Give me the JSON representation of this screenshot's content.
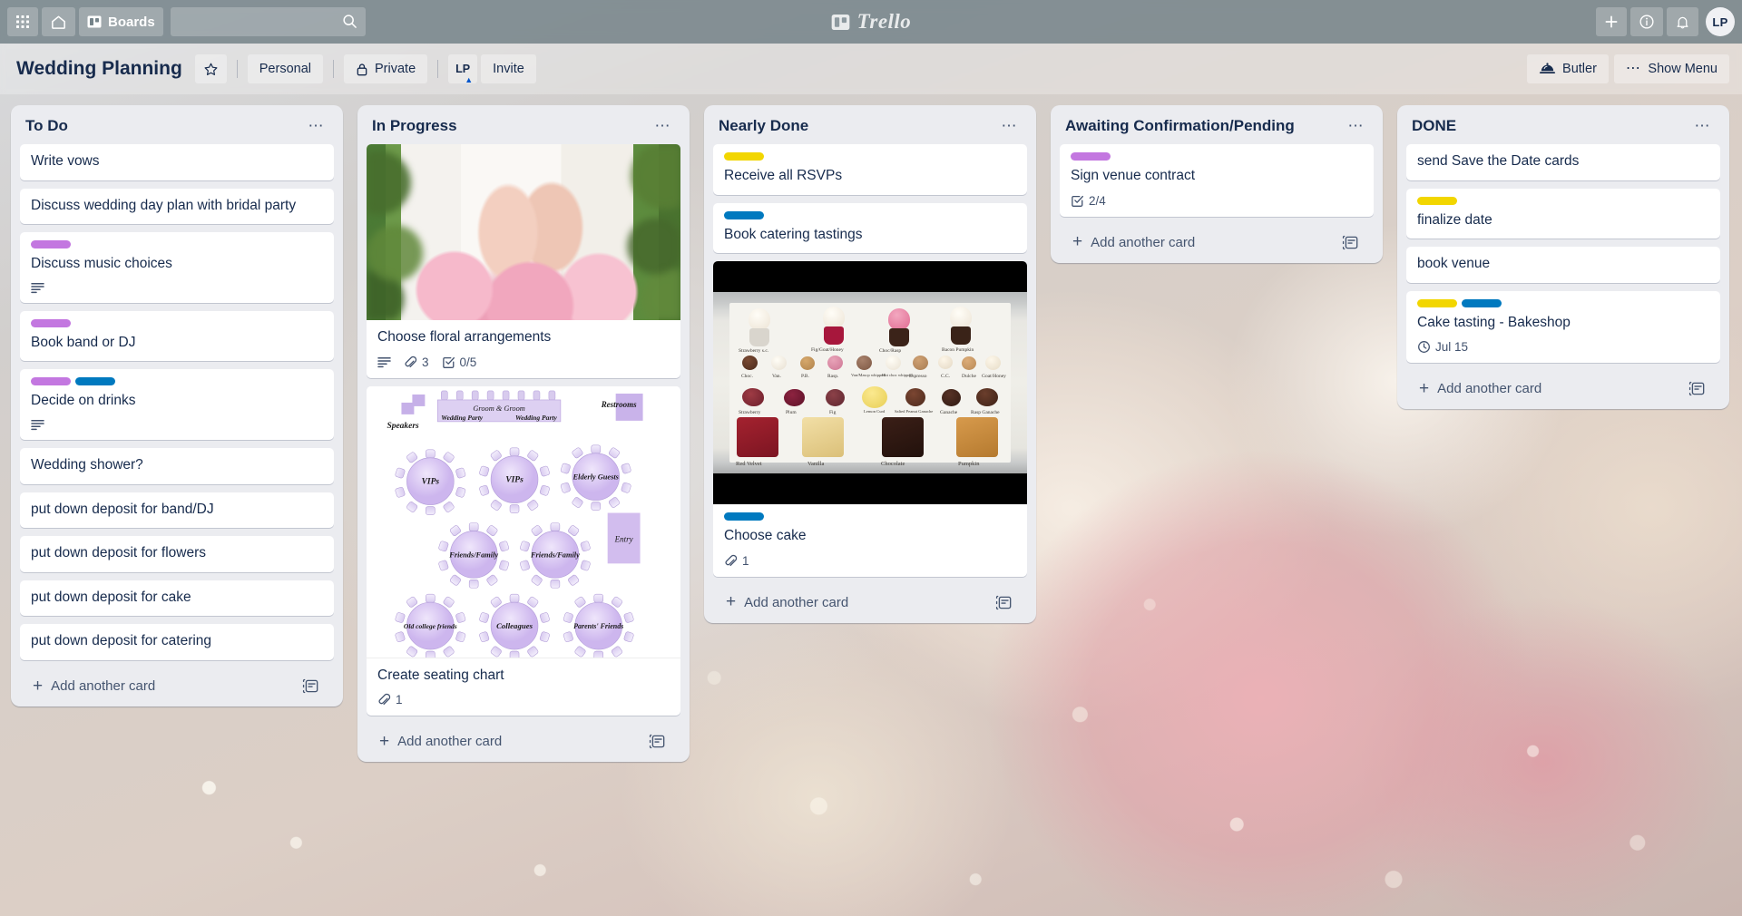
{
  "topnav": {
    "apps_icon": "grid-apps-icon",
    "home_icon": "home-icon",
    "boards_label": "Boards",
    "boards_icon": "board-icon",
    "search": {
      "value": "",
      "placeholder": "",
      "icon": "search-icon"
    },
    "logo_text": "Trello",
    "logo_icon": "trello-board-icon",
    "add_icon": "plus-icon",
    "info_icon": "info-circle-icon",
    "notifications_icon": "bell-icon",
    "avatar_initials": "LP"
  },
  "board_header": {
    "title": "Wedding Planning",
    "star_icon": "star-icon",
    "workspace_label": "Personal",
    "visibility_label": "Private",
    "visibility_icon": "lock-icon",
    "member_initials": "LP",
    "invite_label": "Invite",
    "butler_label": "Butler",
    "butler_icon": "butler-dome-icon",
    "show_menu_label": "Show Menu",
    "show_menu_icon": "ellipsis-icon"
  },
  "add_card_label": "Add another card",
  "card_template_icon": "card-template-icon",
  "list_menu_icon": "ellipsis-icon",
  "label_colors": {
    "purple": "#c377e0",
    "blue": "#0079bf",
    "yellow": "#f2d600"
  },
  "lists": [
    {
      "title": "To Do",
      "cards": [
        {
          "title": "Write vows",
          "labels": [],
          "badges": []
        },
        {
          "title": "Discuss wedding day plan with bridal party",
          "labels": [],
          "badges": []
        },
        {
          "title": "Discuss music choices",
          "labels": [
            "purple"
          ],
          "badges": [
            {
              "type": "description",
              "icon": "description-icon",
              "text": ""
            }
          ]
        },
        {
          "title": "Book band or DJ",
          "labels": [
            "purple"
          ],
          "badges": []
        },
        {
          "title": "Decide on drinks",
          "labels": [
            "purple",
            "blue"
          ],
          "badges": [
            {
              "type": "description",
              "icon": "description-icon",
              "text": ""
            }
          ]
        },
        {
          "title": "Wedding shower?",
          "labels": [],
          "badges": []
        },
        {
          "title": "put down deposit for band/DJ",
          "labels": [],
          "badges": []
        },
        {
          "title": "put down deposit for flowers",
          "labels": [],
          "badges": []
        },
        {
          "title": "put down deposit for cake",
          "labels": [],
          "badges": []
        },
        {
          "title": "put down deposit for catering",
          "labels": [],
          "badges": []
        }
      ]
    },
    {
      "title": "In Progress",
      "cards": [
        {
          "title": "Choose floral arrangements",
          "labels": [],
          "cover": "bride-holding-pink-peony-bouquet-photo",
          "badges": [
            {
              "type": "description",
              "icon": "description-icon",
              "text": ""
            },
            {
              "type": "attachment",
              "icon": "paperclip-icon",
              "text": "3"
            },
            {
              "type": "checklist",
              "icon": "checklist-icon",
              "text": "0/5"
            }
          ]
        },
        {
          "title": "Create seating chart",
          "labels": [],
          "cover": "wedding-seating-chart-diagram",
          "badges": [
            {
              "type": "attachment",
              "icon": "paperclip-icon",
              "text": "1"
            }
          ]
        }
      ]
    },
    {
      "title": "Nearly Done",
      "cards": [
        {
          "title": "Receive all RSVPs",
          "labels": [
            "yellow"
          ],
          "badges": []
        },
        {
          "title": "Book catering tastings",
          "labels": [
            "blue"
          ],
          "badges": []
        },
        {
          "title": "Choose cake",
          "labels": [
            "blue"
          ],
          "cover": "cake-tasting-tray-photo",
          "badges": [
            {
              "type": "attachment",
              "icon": "paperclip-icon",
              "text": "1"
            }
          ]
        }
      ]
    },
    {
      "title": "Awaiting Confirmation/Pending",
      "cards": [
        {
          "title": "Sign venue contract",
          "labels": [
            "purple"
          ],
          "badges": [
            {
              "type": "checklist",
              "icon": "checklist-icon",
              "text": "2/4"
            }
          ]
        }
      ]
    },
    {
      "title": "DONE",
      "cards": [
        {
          "title": "send Save the Date cards",
          "labels": [],
          "badges": []
        },
        {
          "title": "finalize date",
          "labels": [
            "yellow"
          ],
          "badges": []
        },
        {
          "title": "book venue",
          "labels": [],
          "badges": []
        },
        {
          "title": "Cake tasting - Bakeshop",
          "labels": [
            "yellow",
            "blue"
          ],
          "badges": [
            {
              "type": "due-date",
              "icon": "clock-icon",
              "text": "Jul 15"
            }
          ]
        }
      ]
    }
  ],
  "seating_chart": {
    "head_table": {
      "center": "Groom & Groom",
      "left": "Wedding Party",
      "right": "Wedding Party"
    },
    "zones": [
      {
        "label": "Speakers"
      },
      {
        "label": "Restrooms"
      },
      {
        "label": "Entry"
      }
    ],
    "tables": [
      "VIPs",
      "VIPs",
      "Elderly Guests",
      "Friends/Family",
      "Friends/Family",
      "Old college friends",
      "Colleagues",
      "Parents' Friends"
    ]
  },
  "cake_tray": {
    "cupcakes": [
      "Strawberry s.c.",
      "Fig/Goat/Honey",
      "Choc/Rasp",
      "Bacon Pumpkin"
    ],
    "frostings": [
      "Choc.",
      "Van.",
      "P.B.",
      "Rasp.",
      "Van/Mascp whipped",
      "Hot choc whipped",
      "Espresso",
      "C.C.",
      "Dulche",
      "Goat/Honey"
    ],
    "fillings": [
      "Strawberry",
      "Plum",
      "Fig",
      "Lemon Curd",
      "Salted Peanut Ganache",
      "Ganache",
      "Rasp Ganache"
    ],
    "cakes": [
      "Red Velvet",
      "Vanilla",
      "Chocolate",
      "Pumpkin"
    ]
  }
}
